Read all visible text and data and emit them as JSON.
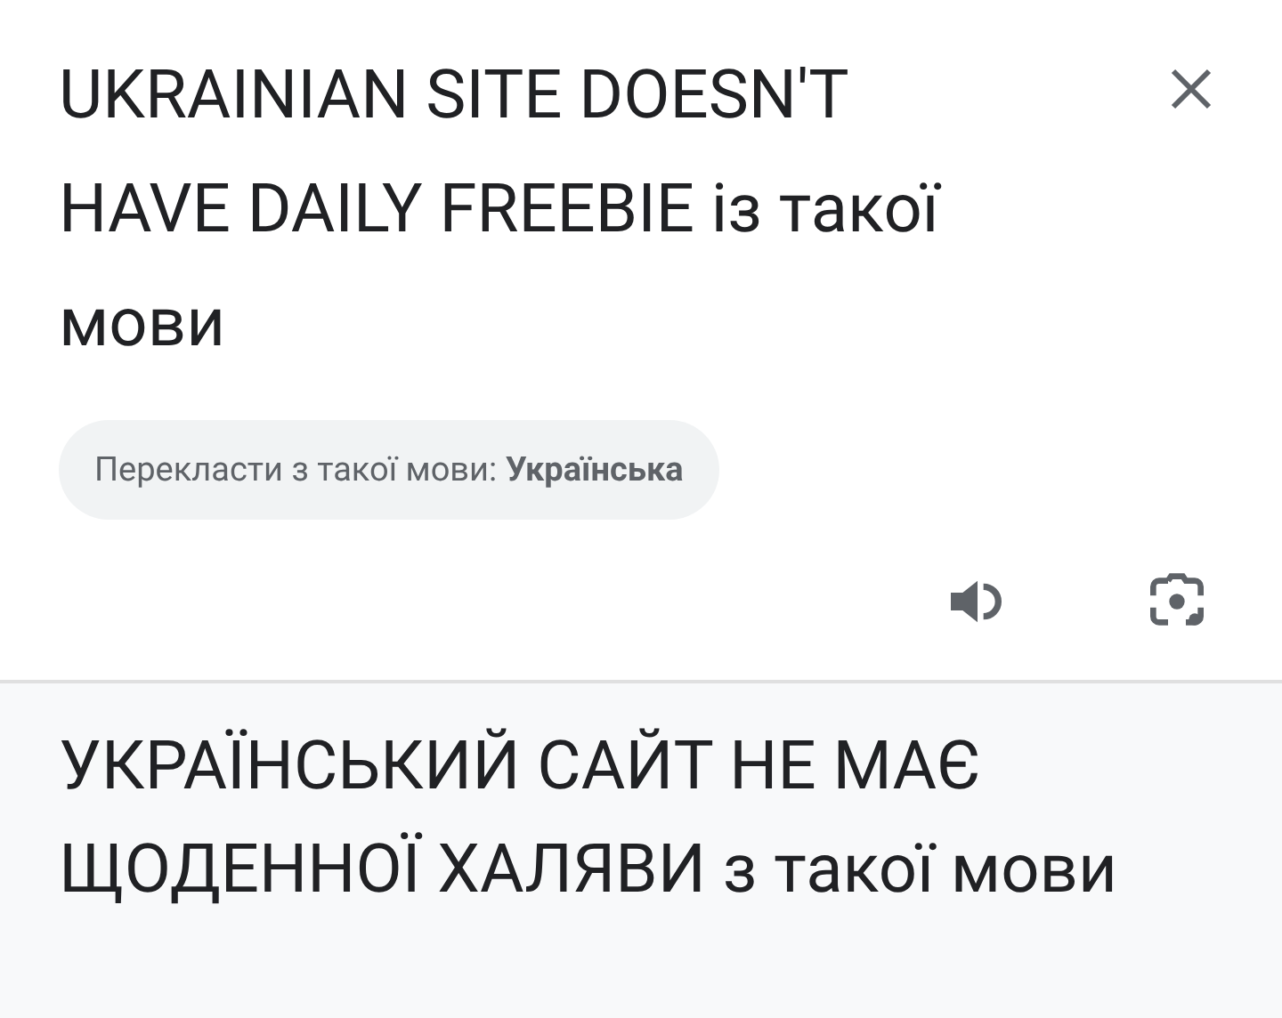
{
  "source": {
    "text": "UKRAINIAN SITE DOESN'T HAVE DAILY FREEBIE із такої мови",
    "detected_language_chip": "Перекласти з такої мови: **Українська**"
  },
  "translation": {
    "text": "УКРАЇНСЬКИЙ САЙТ НЕ МАЄ ЩОДЕННОЇ ХАЛЯВИ з такої мови"
  }
}
